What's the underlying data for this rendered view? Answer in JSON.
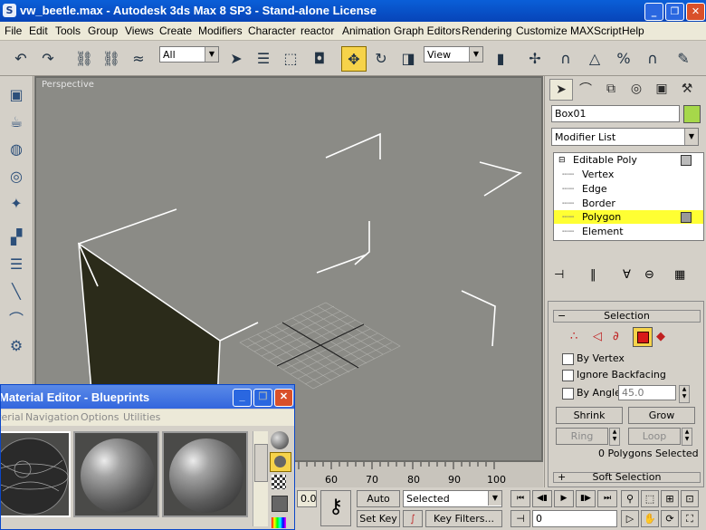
{
  "window": {
    "title": "vw_beetle.max - Autodesk 3ds Max 8 SP3  - Stand-alone License",
    "controls": [
      "_",
      "❐",
      "✕"
    ]
  },
  "menu": [
    "File",
    "Edit",
    "Tools",
    "Group",
    "Views",
    "Create",
    "Modifiers",
    "Character",
    "reactor",
    "Animation",
    "Graph Editors",
    "Rendering",
    "Customize",
    "MAXScript",
    "Help"
  ],
  "toolbar": {
    "selection_filter": "All",
    "reference_coord": "View"
  },
  "viewport": {
    "label": "Perspective",
    "colors": {
      "background": "#8b8b86",
      "wire": "#ffffff",
      "shaded_face": "#2b2b1a"
    }
  },
  "timeline": {
    "ticks": [
      "60",
      "70",
      "80",
      "90",
      "100"
    ]
  },
  "bottom": {
    "time_value": "0.0",
    "auto_key": "Auto Key",
    "set_key": "Set Key",
    "selected_combo": "Selected",
    "key_filters": "Key Filters...",
    "frame": "0"
  },
  "command_panel": {
    "object_name": "Box01",
    "object_color": "#a6d84a",
    "modifier_list": "Modifier List",
    "stack": {
      "root": "Editable Poly",
      "items": [
        "Vertex",
        "Edge",
        "Border",
        "Polygon",
        "Element"
      ],
      "selected": "Polygon"
    },
    "selection": {
      "rollout_title": "Selection",
      "by_vertex": "By Vertex",
      "ignore_backfacing": "Ignore Backfacing",
      "by_angle": "By Angle:",
      "angle_value": "45.0",
      "shrink": "Shrink",
      "grow": "Grow",
      "ring": "Ring",
      "loop": "Loop",
      "status": "0 Polygons Selected"
    },
    "soft_selection_title": "Soft Selection"
  },
  "material_editor": {
    "title": "Material Editor - Blueprints",
    "menu": [
      "Material",
      "Navigation",
      "Options",
      "Utilities"
    ]
  }
}
